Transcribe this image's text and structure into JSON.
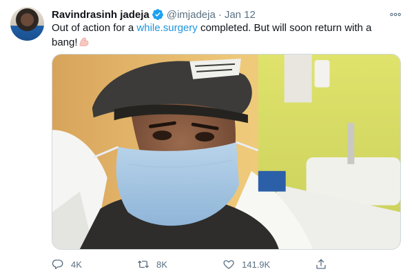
{
  "tweet": {
    "author_name": "Ravindrasinh jadeja",
    "handle": "@imjadeja",
    "separator": "·",
    "date": "Jan 12",
    "text_before": "Out of action for a ",
    "link_text": "while.surgery",
    "text_after": " completed. But will soon return with a bang!",
    "emoji": "flexed-biceps-emoji"
  },
  "actions": {
    "replies": "4K",
    "retweets": "8K",
    "likes": "141.9K"
  },
  "colors": {
    "link": "#1b95e0",
    "verified": "#1da1f2",
    "muted": "#5b7083"
  },
  "icons": [
    "verified-badge-icon",
    "more-icon",
    "reply-icon",
    "retweet-icon",
    "like-icon",
    "share-icon"
  ]
}
